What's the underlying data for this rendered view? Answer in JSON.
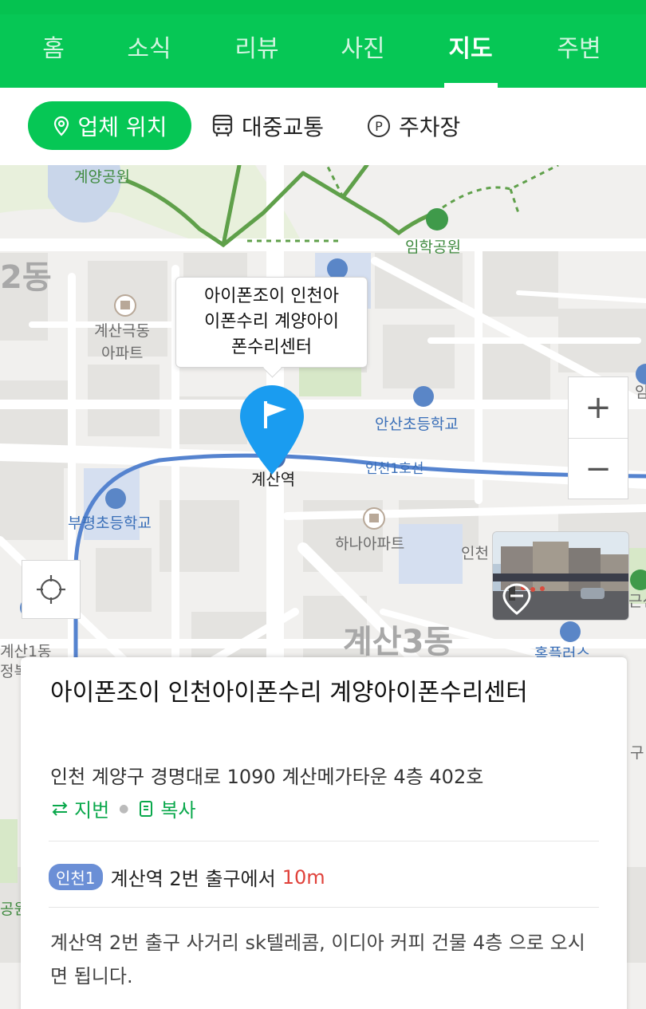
{
  "tabs": [
    {
      "label": "홈"
    },
    {
      "label": "소식"
    },
    {
      "label": "리뷰"
    },
    {
      "label": "사진"
    },
    {
      "label": "지도",
      "active": true
    },
    {
      "label": "주변"
    }
  ],
  "subtabs": {
    "location": "업체 위치",
    "transit": "대중교통",
    "parking": "주차장"
  },
  "map": {
    "labels": {
      "park1": "계양공원",
      "park2": "임학공원",
      "dong2": "2동",
      "apt1_line1": "계산극동",
      "apt1_line2": "아파트",
      "school1": "안산초등학교",
      "school2": "부평초등학교",
      "station": "계산역",
      "line_name": "인천1호선",
      "apt2": "하나아파트",
      "incheon_part": "인천",
      "dong3": "계산3동",
      "dong1_line1": "계산1동",
      "dong1_line2": "정복",
      "homeplus": "홈플러스",
      "edge_park": "공원",
      "edge_right1": "임",
      "edge_right2": "근신",
      "edge_right3": "구"
    },
    "callout_lines": [
      "아이폰조이 인천아",
      "이폰수리 계양아이",
      "폰수리센터"
    ],
    "zoom_in": "+",
    "zoom_out": "−"
  },
  "place": {
    "title": "아이폰조이 인천아이폰수리 계양아이폰수리센터",
    "address": "인천 계양구 경명대로 1090 계산메가타운 4층 402호",
    "jibun": "지번",
    "copy": "복사",
    "subway_line": "인천1",
    "subway_text": "계산역 2번 출구에서",
    "subway_distance": "10m",
    "directions": "계산역 2번 출구 사거리 sk텔레콤, 이디아 커피 건물 4층 으로 오시면 됩니다."
  },
  "colors": {
    "brand": "#06c755",
    "subway_line": "#6b8fd6",
    "distance": "#e0413a",
    "pin": "#1a9cf0"
  }
}
